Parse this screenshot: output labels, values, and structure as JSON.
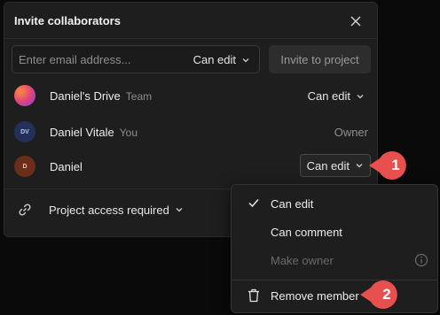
{
  "modal": {
    "title": "Invite collaborators",
    "email_placeholder": "Enter email address...",
    "permission_select": "Can edit",
    "invite_button": "Invite to project"
  },
  "members": [
    {
      "name": "Daniel's Drive",
      "tag": "Team",
      "permission": "Can edit",
      "avatar": "gradient",
      "initials": ""
    },
    {
      "name": "Daniel Vitale",
      "tag": "You",
      "permission": "Owner",
      "avatar": "navy",
      "initials": "DV"
    },
    {
      "name": "Daniel",
      "tag": "",
      "permission": "Can edit",
      "avatar": "brown",
      "initials": "D"
    }
  ],
  "access": {
    "label": "Project access required"
  },
  "menu": {
    "items": [
      {
        "label": "Can edit",
        "checked": true
      },
      {
        "label": "Can comment",
        "checked": false
      },
      {
        "label": "Make owner",
        "disabled": true
      },
      {
        "label": "Remove member"
      }
    ]
  },
  "annotations": [
    {
      "number": "1"
    },
    {
      "number": "2"
    }
  ],
  "colors": {
    "badge": "#e84f4f",
    "background": "#0a0a0a",
    "panel": "#1e1e1e"
  }
}
